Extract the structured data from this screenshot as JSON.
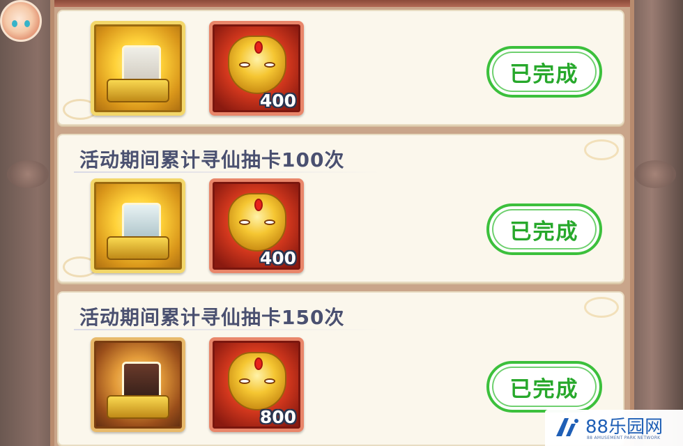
{
  "tasks": [
    {
      "title": "",
      "hero_reward": "hero-card-chest",
      "token_quantity": "400",
      "status_label": "已完成"
    },
    {
      "title": "活动期间累计寻仙抽卡100次",
      "hero_reward": "hero-card-chest",
      "token_quantity": "400",
      "status_label": "已完成"
    },
    {
      "title": "活动期间累计寻仙抽卡150次",
      "hero_reward": "hero-card-chest",
      "token_quantity": "800",
      "status_label": "已完成"
    }
  ],
  "watermark": {
    "brand": "88乐园网",
    "subtitle": "88 AMUSEMENT PARK NETWORK"
  },
  "colors": {
    "done_green": "#27a82b",
    "title_text": "#4a5070",
    "card_bg": "#fbf7ec",
    "watermark_blue": "#1f5fb6"
  }
}
